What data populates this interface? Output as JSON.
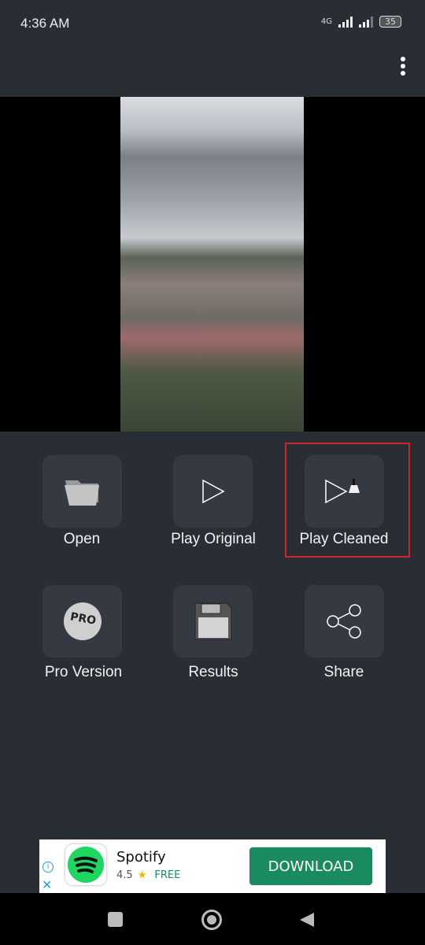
{
  "status": {
    "time": "4:36 AM",
    "network": "4G",
    "battery": "35"
  },
  "menu_icon": "more-vertical-icon",
  "actions": [
    {
      "label": "Open",
      "icon": "folder-icon"
    },
    {
      "label": "Play Original",
      "icon": "play-icon"
    },
    {
      "label": "Play Cleaned",
      "icon": "play-broom-icon",
      "highlighted": true
    },
    {
      "label": "Pro Version",
      "icon": "pro-badge-icon"
    },
    {
      "label": "Results",
      "icon": "floppy-disk-icon"
    },
    {
      "label": "Share",
      "icon": "share-icon"
    }
  ],
  "highlight_color": "#d0232a",
  "ad": {
    "app": "Spotify",
    "rating": "4.5",
    "star": "★",
    "price": "FREE",
    "cta": "DOWNLOAD",
    "cta_color": "#1a8a5f",
    "logo_color": "#1ed760"
  }
}
